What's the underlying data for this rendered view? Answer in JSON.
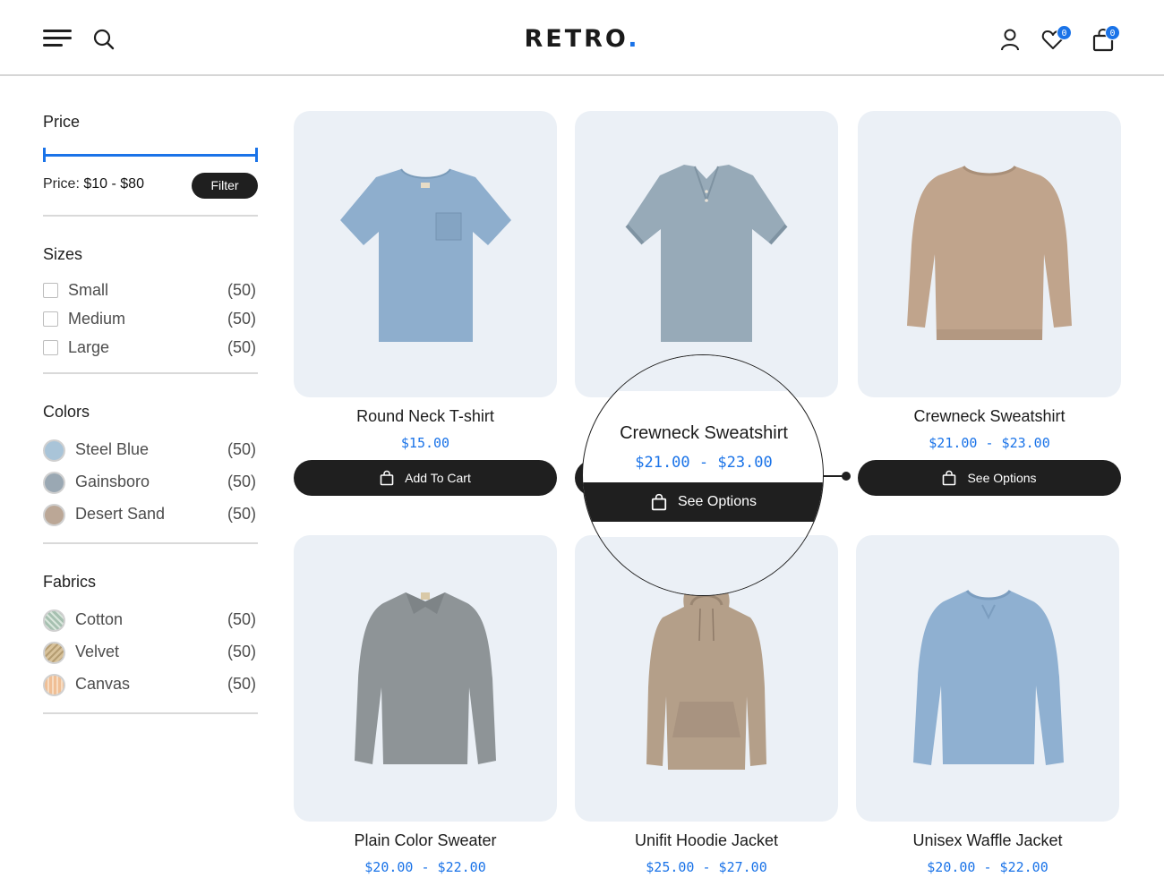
{
  "header": {
    "logo_text": "RETRO",
    "logo_dot": ".",
    "wishlist_count": "0",
    "cart_count": "0",
    "accent_color": "#1a73e8"
  },
  "filters": {
    "price": {
      "title": "Price",
      "label_prefix": "Price:",
      "range_text": "$10 - $80",
      "button_label": "Filter"
    },
    "sizes": {
      "title": "Sizes",
      "items": [
        {
          "label": "Small",
          "count": "(50)"
        },
        {
          "label": "Medium",
          "count": "(50)"
        },
        {
          "label": "Large",
          "count": "(50)"
        }
      ]
    },
    "colors": {
      "title": "Colors",
      "items": [
        {
          "label": "Steel Blue",
          "count": "(50)",
          "swatch": "#a9c4d8"
        },
        {
          "label": "Gainsboro",
          "count": "(50)",
          "swatch": "#9aa8b3"
        },
        {
          "label": "Desert Sand",
          "count": "(50)",
          "swatch": "#bba796"
        }
      ]
    },
    "fabrics": {
      "title": "Fabrics",
      "items": [
        {
          "label": "Cotton",
          "count": "(50)",
          "swatch": "#a6c0b0"
        },
        {
          "label": "Velvet",
          "count": "(50)",
          "swatch": "#d8c29a"
        },
        {
          "label": "Canvas",
          "count": "(50)",
          "swatch": "#f0bf95"
        }
      ]
    }
  },
  "products": [
    {
      "name": "Round Neck T-shirt",
      "price": "$15.00",
      "button": "Add To Cart",
      "color": "#8eaecd",
      "icon": "tshirt-icon"
    },
    {
      "name": "Crewneck Sweatshirt",
      "price": "$21.00 - $23.00",
      "button": "See Options",
      "color": "#97aab8",
      "icon": "polo-icon"
    },
    {
      "name": "Crewneck Sweatshirt",
      "price": "$21.00 - $23.00",
      "button": "See Options",
      "color": "#c0a48c",
      "icon": "sweatshirt-icon"
    },
    {
      "name": "Plain Color Sweater",
      "price": "$20.00 - $22.00",
      "color": "#8e9497",
      "icon": "sweater-icon"
    },
    {
      "name": "Unifit Hoodie Jacket",
      "price": "$25.00 - $27.00",
      "color": "#b49f89",
      "icon": "hoodie-icon"
    },
    {
      "name": "Unisex Waffle Jacket",
      "price": "$20.00 - $22.00",
      "color": "#8fb0d1",
      "icon": "waffle-jacket-icon"
    }
  ],
  "magnifier": {
    "name": "Crewneck Sweatshirt",
    "price": "$21.00 - $23.00",
    "button": "See Options"
  }
}
